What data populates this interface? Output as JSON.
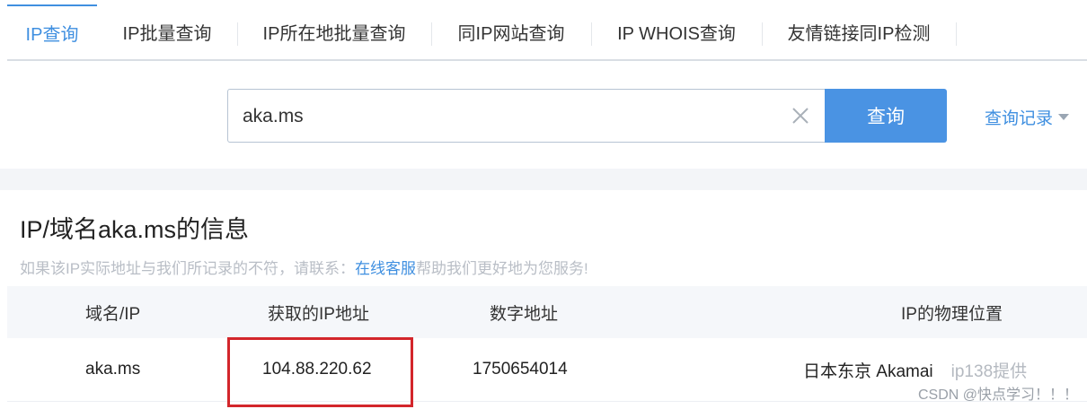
{
  "tabs": [
    {
      "label": "IP查询",
      "active": true
    },
    {
      "label": "IP批量查询",
      "active": false
    },
    {
      "label": "IP所在地批量查询",
      "active": false
    },
    {
      "label": "同IP网站查询",
      "active": false
    },
    {
      "label": "IP WHOIS查询",
      "active": false
    },
    {
      "label": "友情链接同IP检测",
      "active": false
    }
  ],
  "search": {
    "value": "aka.ms",
    "button_label": "查询",
    "history_label": "查询记录"
  },
  "info": {
    "title": "IP/域名aka.ms的信息",
    "note_prefix": "如果该IP实际地址与我们所记录的不符，请联系：",
    "note_link": "在线客服",
    "note_suffix": "帮助我们更好地为您服务!"
  },
  "table": {
    "headers": [
      "域名/IP",
      "获取的IP地址",
      "数字地址",
      "IP的物理位置"
    ],
    "rows": [
      {
        "domain": "aka.ms",
        "ip": "104.88.220.62",
        "numeric": "1750654014",
        "location": "日本东京 Akamai",
        "provider": "ip138提供"
      }
    ]
  },
  "watermark": "CSDN @快点学习！！！",
  "colors": {
    "accent": "#3f8fe0",
    "button": "#4a93e3",
    "highlight": "#d3262b"
  }
}
